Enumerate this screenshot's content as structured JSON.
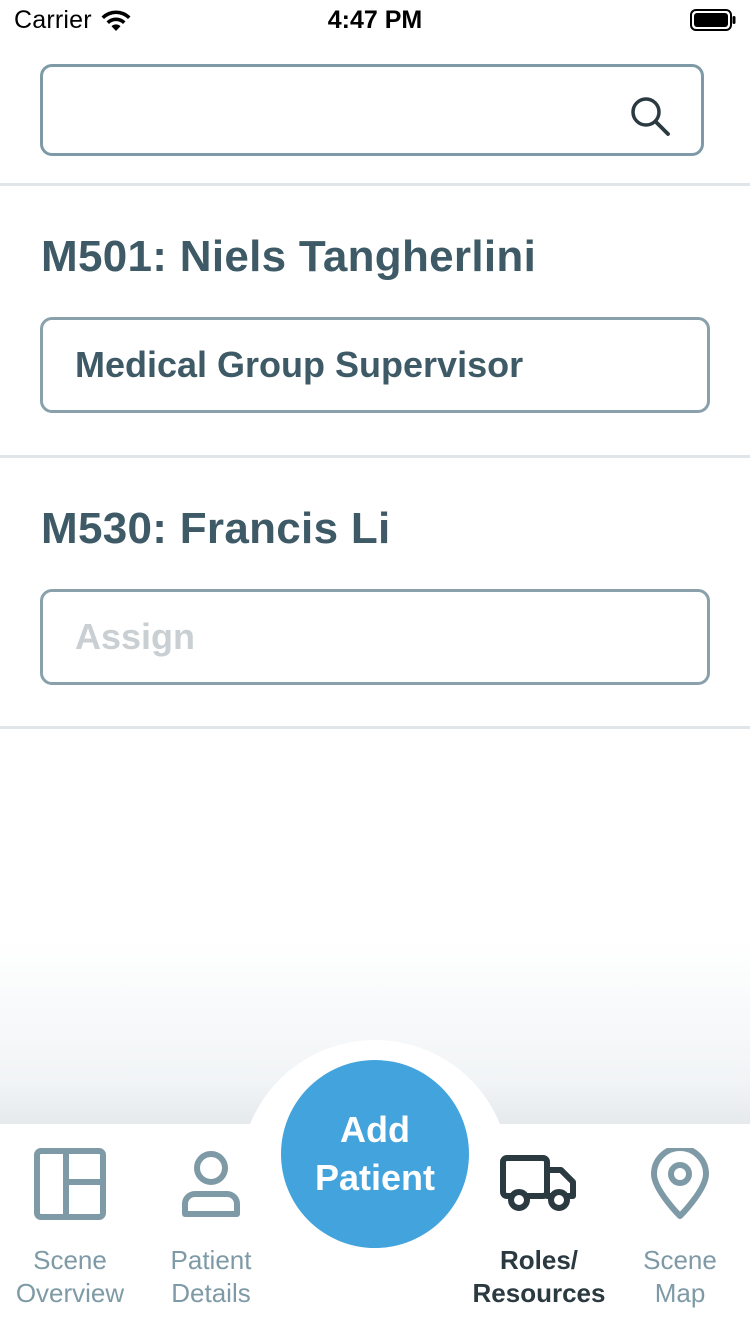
{
  "status_bar": {
    "carrier": "Carrier",
    "time": "4:47 PM"
  },
  "search": {
    "value": "",
    "placeholder": ""
  },
  "roles": [
    {
      "title": "M501: Niels Tangherlini",
      "assignment": "Medical Group Supervisor",
      "assigned": true
    },
    {
      "title": "M530: Francis Li",
      "assignment": "Assign",
      "assigned": false
    }
  ],
  "add_patient": {
    "line1": "Add",
    "line2": "Patient"
  },
  "tabs": [
    {
      "label_line1": "Scene",
      "label_line2": "Overview",
      "icon": "layout-grid-icon",
      "active": false
    },
    {
      "label_line1": "Patient",
      "label_line2": "Details",
      "icon": "person-icon",
      "active": false
    },
    {
      "label_line1": "Roles/",
      "label_line2": "Resources",
      "icon": "truck-icon",
      "active": true
    },
    {
      "label_line1": "Scene",
      "label_line2": "Map",
      "icon": "map-pin-icon",
      "active": false
    }
  ],
  "colors": {
    "primary_text": "#3d5a66",
    "border": "#7e9aa6",
    "inactive_tab": "#7e9aa6",
    "active_tab": "#2b3a41",
    "accent": "#43a3dc",
    "placeholder": "#c9cfd2"
  }
}
